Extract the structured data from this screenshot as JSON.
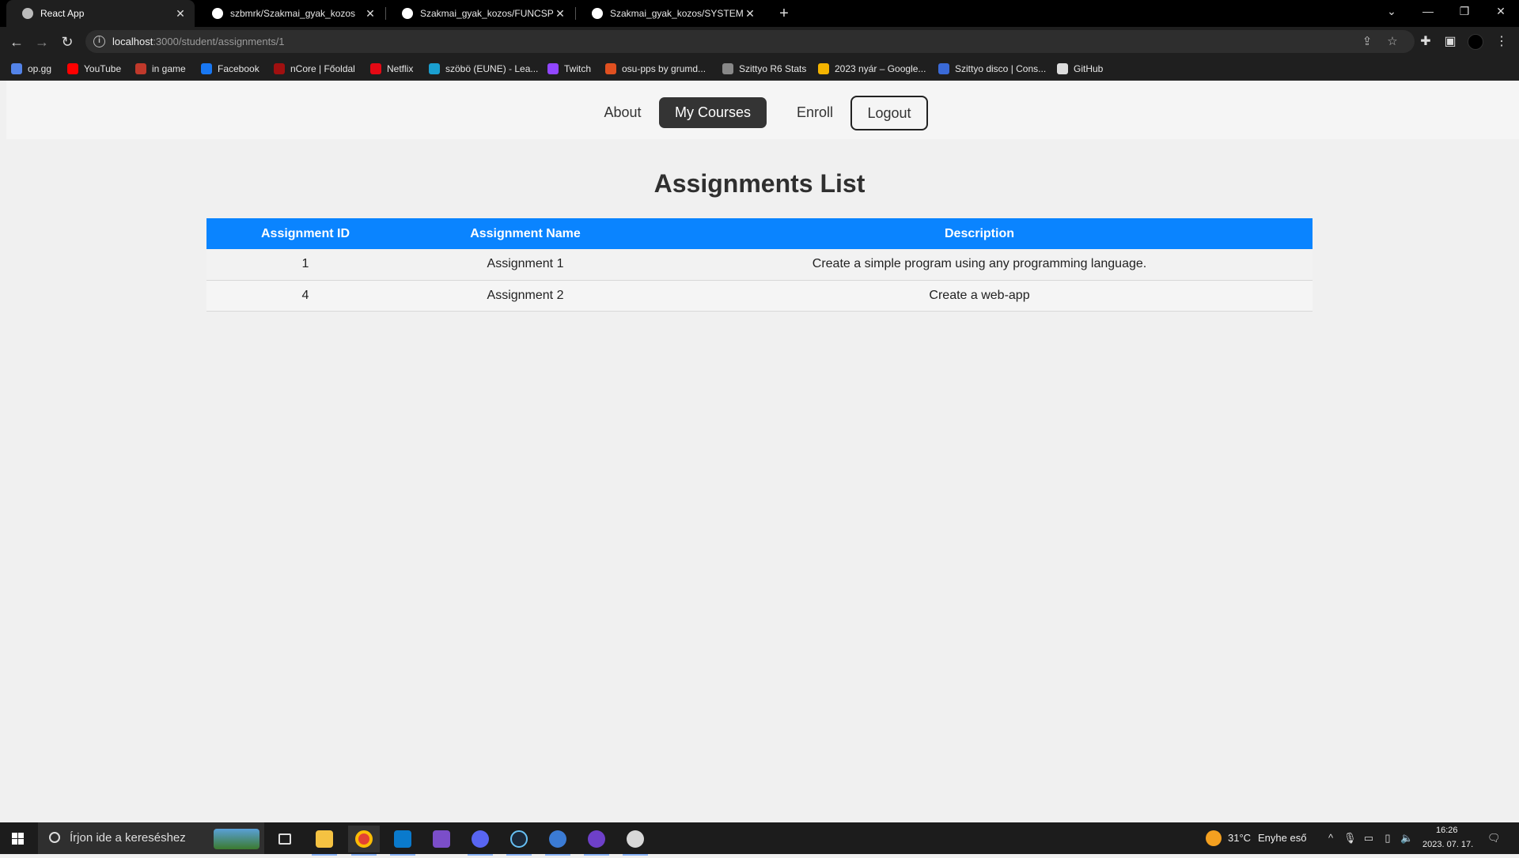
{
  "browser": {
    "tabs": [
      {
        "title": "React App",
        "active": true
      },
      {
        "title": "szbmrk/Szakmai_gyak_kozos",
        "active": false
      },
      {
        "title": "Szakmai_gyak_kozos/FUNCSPEC.",
        "active": false
      },
      {
        "title": "Szakmai_gyak_kozos/SYSTEMPLA",
        "active": false
      }
    ],
    "url_host": "localhost",
    "url_path": ":3000/student/assignments/1",
    "bookmarks": [
      {
        "label": "op.gg",
        "color": "#5383e8"
      },
      {
        "label": "YouTube",
        "color": "#ff0000"
      },
      {
        "label": "in game",
        "color": "#c0392b"
      },
      {
        "label": "Facebook",
        "color": "#1877f2"
      },
      {
        "label": "nCore | Főoldal",
        "color": "#a01010"
      },
      {
        "label": "Netflix",
        "color": "#e50914"
      },
      {
        "label": "szöbö (EUNE) - Lea...",
        "color": "#1a9fd0"
      },
      {
        "label": "Twitch",
        "color": "#9146ff"
      },
      {
        "label": "osu-pps by grumd...",
        "color": "#e05020"
      },
      {
        "label": "Szittyo R6 Stats",
        "color": "#888888"
      },
      {
        "label": "2023 nyár – Google...",
        "color": "#f4b400"
      },
      {
        "label": "Szittyo disco | Cons...",
        "color": "#3a6ad8"
      },
      {
        "label": "GitHub",
        "color": "#dddddd"
      }
    ]
  },
  "nav": {
    "about": "About",
    "my_courses": "My Courses",
    "enroll": "Enroll",
    "logout": "Logout"
  },
  "page": {
    "title": "Assignments List"
  },
  "table": {
    "headers": [
      "Assignment ID",
      "Assignment Name",
      "Description"
    ],
    "rows": [
      {
        "id": "1",
        "name": "Assignment 1",
        "description": "Create a simple program using any programming language."
      },
      {
        "id": "4",
        "name": "Assignment 2",
        "description": "Create a web-app"
      }
    ]
  },
  "colors": {
    "accent": "#0a84ff",
    "active_nav": "#343434"
  },
  "taskbar": {
    "search_placeholder": "Írjon ide a kereséshez",
    "weather_temp": "31°C",
    "weather_text": "Enyhe eső",
    "time": "16:26",
    "date": "2023. 07. 17."
  }
}
